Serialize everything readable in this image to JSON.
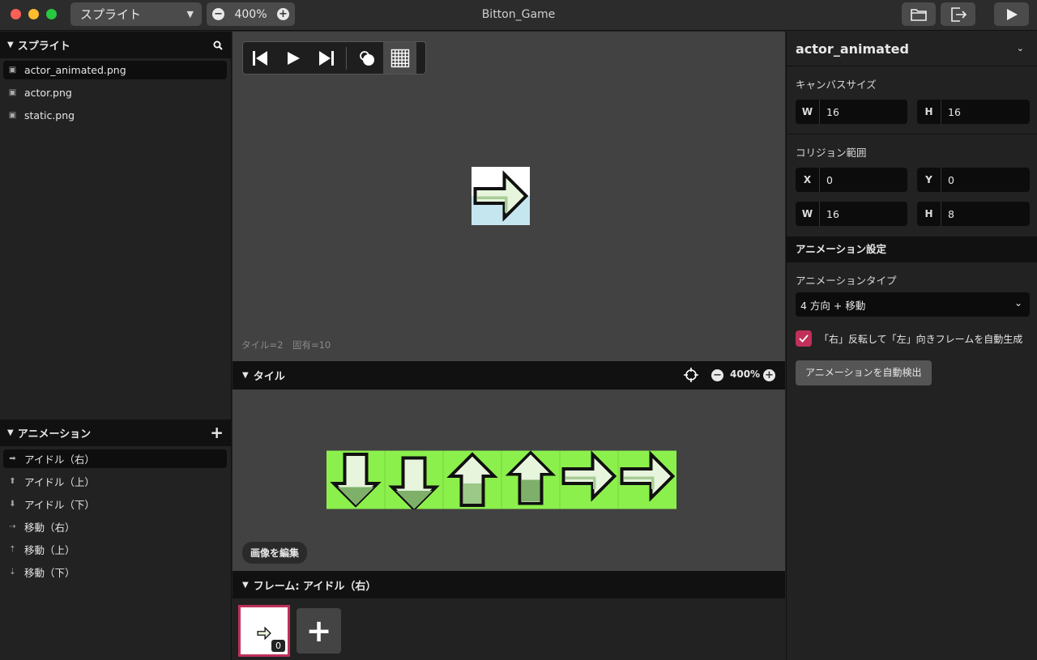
{
  "window": {
    "title": "Bitton_Game"
  },
  "toolbar": {
    "mode_select": "スプライト",
    "zoom": "400%",
    "zoom_minus": "−",
    "zoom_plus": "+"
  },
  "sprites": {
    "header": "スプライト",
    "items": [
      {
        "label": "actor_animated.png",
        "selected": true
      },
      {
        "label": "actor.png"
      },
      {
        "label": "static.png"
      }
    ]
  },
  "animations": {
    "header": "アニメーション",
    "add": "+",
    "items": [
      {
        "label": "アイドル（右）",
        "icon": "arrow-right-icon",
        "selected": true
      },
      {
        "label": "アイドル（上）",
        "icon": "arrow-up-icon"
      },
      {
        "label": "アイドル（下）",
        "icon": "arrow-down-icon"
      },
      {
        "label": "移動（右）",
        "icon": "arrow-right-dotted-icon"
      },
      {
        "label": "移動（上）",
        "icon": "arrow-up-dotted-icon"
      },
      {
        "label": "移動（下）",
        "icon": "arrow-down-dotted-icon"
      }
    ]
  },
  "canvas": {
    "info": "タイル=2　固有=10"
  },
  "tiles": {
    "header": "タイル",
    "zoom": "400%",
    "edit_image": "画像を編集"
  },
  "frames": {
    "header": "フレーム: アイドル（右）",
    "frame_index": "0",
    "add": "+"
  },
  "inspector": {
    "name": "actor_animated",
    "canvas_size_label": "キャンバスサイズ",
    "canvas_w_key": "W",
    "canvas_w": "16",
    "canvas_h_key": "H",
    "canvas_h": "16",
    "collision_label": "コリジョン範囲",
    "col_x_key": "X",
    "col_x": "0",
    "col_y_key": "Y",
    "col_y": "0",
    "col_w_key": "W",
    "col_w": "16",
    "col_h_key": "H",
    "col_h": "8",
    "anim_settings": "アニメーション設定",
    "anim_type_label": "アニメーションタイプ",
    "anim_type_value": "4 方向 + 移動",
    "flip_checkbox": "「右」反転して「左」向きフレームを自動生成",
    "flip_checked": true,
    "auto_detect_button": "アニメーションを自動検出"
  },
  "colors": {
    "accent": "#c0305a",
    "tile_bg": "#8cf04c",
    "arrow_fill": "#e6f5dc",
    "arrow_dark": "#7fb06a"
  }
}
